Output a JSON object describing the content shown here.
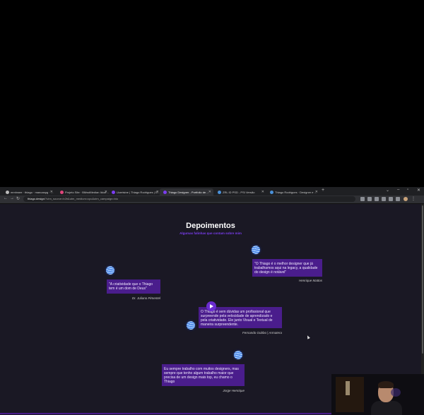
{
  "browser": {
    "tabs": [
      {
        "label": "mrnhwee · thiago · manoaspg · …",
        "favicon_color": "#bbbbbb",
        "active": false
      },
      {
        "label": "Projeto Site · BMwdMedian Ikkur…",
        "favicon_color": "#e0457b",
        "active": false
      },
      {
        "label": "Ucertsine | Thiago Rodrigues | D…",
        "favicon_color": "#7b3df0",
        "active": false
      },
      {
        "label": "Thiago Designer - Portfolio de…",
        "favicon_color": "#7b3df0",
        "active": true
      },
      {
        "label": "ZRL ID PSD - PSI Versão",
        "favicon_color": "#4a90d9",
        "active": false
      },
      {
        "label": "Thiago Rodrigues · Designer e …",
        "favicon_color": "#4a90d9",
        "active": false
      }
    ],
    "new_tab": "+",
    "window_controls": [
      "⌄",
      "–",
      "▫",
      "✕"
    ],
    "nav": {
      "back": "←",
      "forward": "→",
      "reload": "↻"
    },
    "url_host": "thiago.design",
    "url_path": "/?utm_source=b2b&utm_medium=cpc&utm_campaign=bio"
  },
  "section": {
    "title": "Depoimentos",
    "subtitle": "Algumas falinhas que contam sobre mim"
  },
  "testimonials": [
    {
      "quote": "\"O Thiago é o melhor designer que já trabalhamos aqui na legacy, a qualidade do design é notável\"",
      "author": "Henrique Mattos"
    },
    {
      "quote": "\"A criatividade que o Thiago tem é um dom de Deus\"",
      "author": "Dr. Juliano Pimentel"
    },
    {
      "quote": "O Thiago é sem dúvidas um profissional que surpreende pela velocidade de aprendizado e pela criatividade. Ele junto Visual e Textual de maneira surpreendente.",
      "author": "Fernando Gobbo | Armatera"
    },
    {
      "quote": "Eu sempre trabalho com muitos designers, mas sempre que tenho algum trabalho maior que precisa de um design mais top, eu chamo o Thiago",
      "author": "Jorge Henrique"
    }
  ],
  "colors": {
    "accent": "#7b3df0",
    "quote_bg": "#4a1d8c",
    "page_bg": "#1a1824"
  }
}
